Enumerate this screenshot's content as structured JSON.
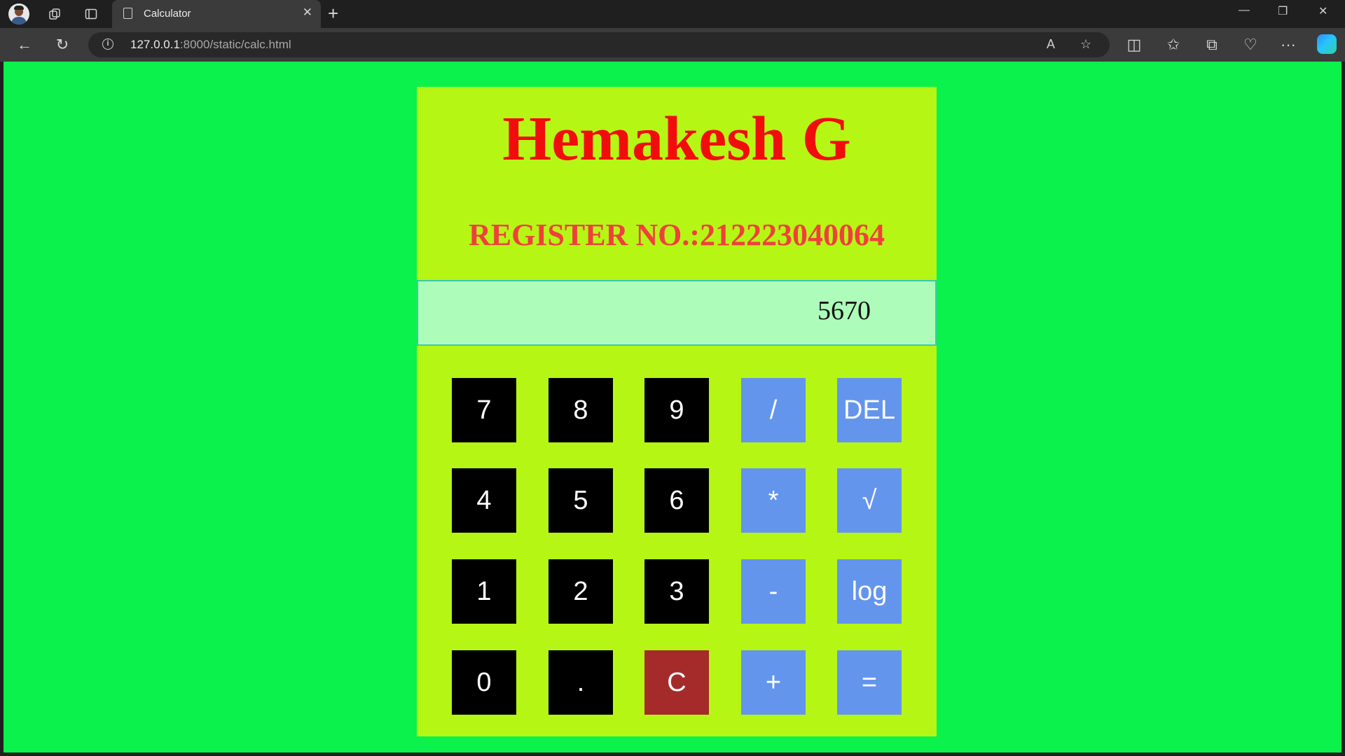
{
  "browser": {
    "tab_title": "Calculator",
    "tab_close": "✕",
    "new_tab": "+",
    "url_host": "127.0.0.1",
    "url_path": ":8000/static/calc.html",
    "info_icon": "i",
    "window_controls": {
      "minimize": "—",
      "restore": "❐",
      "close": "✕"
    },
    "icons": {
      "back": "←",
      "refresh": "↻",
      "read_aloud": "A",
      "favorite": "☆",
      "split": "◫",
      "favorites": "✩",
      "collections": "⧉",
      "health": "♡",
      "more": "···"
    }
  },
  "calculator": {
    "name": "Hemakesh G",
    "register_no": "REGISTER NO.:212223040064",
    "display_value": "5670",
    "keys": {
      "k7": "7",
      "k8": "8",
      "k9": "9",
      "div": "/",
      "del": "DEL",
      "k4": "4",
      "k5": "5",
      "k6": "6",
      "mul": "*",
      "sqrt": "√",
      "k1": "1",
      "k2": "2",
      "k3": "3",
      "sub": "-",
      "log": "log",
      "k0": "0",
      "dot": ".",
      "clear": "C",
      "add": "+",
      "eq": "="
    }
  },
  "colors": {
    "page_bg": "#0af24b",
    "calc_bg": "#b5f615",
    "name_color": "#f20d0d",
    "regno_color": "#f0403b",
    "display_bg": "#adfcba",
    "num_key": "#000000",
    "op_key": "#6495ed",
    "clear_key": "#a52a2a"
  }
}
